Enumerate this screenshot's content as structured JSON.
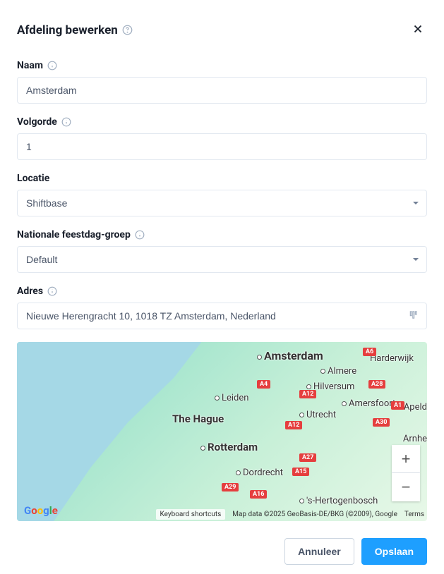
{
  "modal": {
    "title": "Afdeling bewerken"
  },
  "form": {
    "name": {
      "label": "Naam",
      "value": "Amsterdam"
    },
    "order": {
      "label": "Volgorde",
      "value": "1"
    },
    "location": {
      "label": "Locatie",
      "value": "Shiftbase"
    },
    "holiday_group": {
      "label": "Nationale feestdag-groep",
      "value": "Default"
    },
    "address": {
      "label": "Adres",
      "value": "Nieuwe Herengracht 10, 1018 TZ Amsterdam, Nederland"
    }
  },
  "map": {
    "cities": {
      "amsterdam": "Amsterdam",
      "the_hague": "The Hague",
      "rotterdam": "Rotterdam",
      "utrecht": "Utrecht",
      "almere": "Almere",
      "leiden": "Leiden",
      "hilversum": "Hilversum",
      "amersfoort": "Amersfoort",
      "harderwijk": "Harderwijk",
      "apeldoorn": "Apeld",
      "arnhem": "Arnhe",
      "dordrecht": "Dordrecht",
      "shertogenbosch": "'s-Hertogenbosch"
    },
    "roads": {
      "a6": "A6",
      "a4": "A4",
      "a12": "A12",
      "a27": "A27",
      "a29": "A29",
      "a16": "A16",
      "a15": "A15",
      "a28": "A28",
      "a30": "A30",
      "a1": "A1",
      "a12b": "A12"
    },
    "footer": {
      "shortcuts": "Keyboard shortcuts",
      "attribution": "Map data ©2025 GeoBasis-DE/BKG (©2009), Google",
      "terms": "Terms"
    }
  },
  "buttons": {
    "cancel": "Annuleer",
    "save": "Opslaan",
    "zoom_in": "+",
    "zoom_out": "−"
  }
}
